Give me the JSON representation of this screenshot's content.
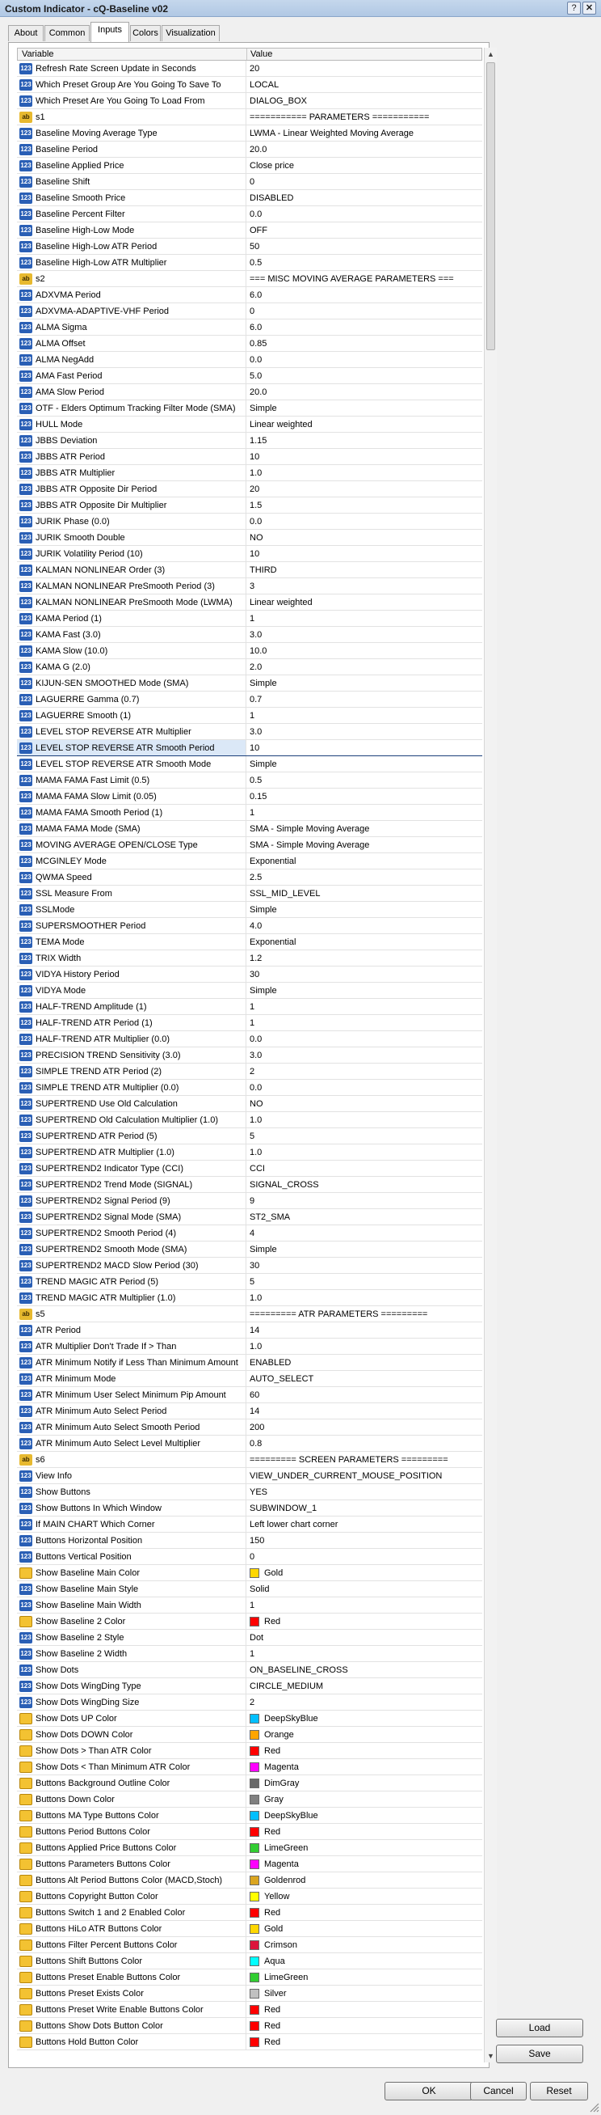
{
  "window": {
    "title": "Custom Indicator - cQ-Baseline v02",
    "help_glyph": "?",
    "close_glyph": "✕"
  },
  "tabs": [
    "About",
    "Common",
    "Inputs",
    "Colors",
    "Visualization"
  ],
  "active_tab": "Inputs",
  "columns": {
    "variable": "Variable",
    "value": "Value"
  },
  "rows": [
    {
      "t": "n",
      "name": "Refresh Rate Screen Update in Seconds",
      "value": "20"
    },
    {
      "t": "n",
      "name": "Which Preset Group Are You Going To Save To",
      "value": "LOCAL"
    },
    {
      "t": "n",
      "name": "Which Preset Are You Going To Load From",
      "value": "DIALOG_BOX"
    },
    {
      "t": "s",
      "name": "s1",
      "value": "=========== PARAMETERS ==========="
    },
    {
      "t": "n",
      "name": "Baseline Moving Average Type",
      "value": "LWMA - Linear Weighted Moving Average"
    },
    {
      "t": "n",
      "name": "Baseline Period",
      "value": "20.0"
    },
    {
      "t": "n",
      "name": "Baseline Applied Price",
      "value": "Close price"
    },
    {
      "t": "n",
      "name": "Baseline Shift",
      "value": "0"
    },
    {
      "t": "n",
      "name": "Baseline Smooth Price",
      "value": "DISABLED"
    },
    {
      "t": "n",
      "name": "Baseline Percent Filter",
      "value": "0.0"
    },
    {
      "t": "n",
      "name": "Baseline High-Low Mode",
      "value": "OFF"
    },
    {
      "t": "n",
      "name": "Baseline High-Low ATR Period",
      "value": "50"
    },
    {
      "t": "n",
      "name": "Baseline High-Low ATR Multiplier",
      "value": "0.5"
    },
    {
      "t": "s",
      "name": "s2",
      "value": "=== MISC MOVING AVERAGE PARAMETERS ==="
    },
    {
      "t": "n",
      "name": "ADXVMA Period",
      "value": "6.0"
    },
    {
      "t": "n",
      "name": "ADXVMA-ADAPTIVE-VHF Period",
      "value": "0"
    },
    {
      "t": "n",
      "name": "ALMA Sigma",
      "value": "6.0"
    },
    {
      "t": "n",
      "name": "ALMA Offset",
      "value": "0.85"
    },
    {
      "t": "n",
      "name": "ALMA NegAdd",
      "value": "0.0"
    },
    {
      "t": "n",
      "name": "AMA Fast Period",
      "value": "5.0"
    },
    {
      "t": "n",
      "name": "AMA Slow Period",
      "value": "20.0"
    },
    {
      "t": "n",
      "name": "OTF - Elders Optimum Tracking Filter Mode (SMA)",
      "value": "Simple"
    },
    {
      "t": "n",
      "name": "HULL Mode",
      "value": "Linear weighted"
    },
    {
      "t": "n",
      "name": "JBBS Deviation",
      "value": "1.15"
    },
    {
      "t": "n",
      "name": "JBBS ATR Period",
      "value": "10"
    },
    {
      "t": "n",
      "name": "JBBS ATR Multiplier",
      "value": "1.0"
    },
    {
      "t": "n",
      "name": "JBBS ATR Opposite Dir Period",
      "value": "20"
    },
    {
      "t": "n",
      "name": "JBBS ATR Opposite Dir Multiplier",
      "value": "1.5"
    },
    {
      "t": "n",
      "name": "JURIK Phase (0.0)",
      "value": "0.0"
    },
    {
      "t": "n",
      "name": "JURIK Smooth Double",
      "value": "NO"
    },
    {
      "t": "n",
      "name": "JURIK Volatility Period (10)",
      "value": "10"
    },
    {
      "t": "n",
      "name": "KALMAN NONLINEAR Order (3)",
      "value": "THIRD"
    },
    {
      "t": "n",
      "name": "KALMAN NONLINEAR PreSmooth Period (3)",
      "value": "3"
    },
    {
      "t": "n",
      "name": "KALMAN NONLINEAR PreSmooth Mode (LWMA)",
      "value": "Linear weighted"
    },
    {
      "t": "n",
      "name": "KAMA Period (1)",
      "value": "1"
    },
    {
      "t": "n",
      "name": "KAMA Fast (3.0)",
      "value": "3.0"
    },
    {
      "t": "n",
      "name": "KAMA Slow (10.0)",
      "value": "10.0"
    },
    {
      "t": "n",
      "name": "KAMA G (2.0)",
      "value": "2.0"
    },
    {
      "t": "n",
      "name": "KIJUN-SEN SMOOTHED Mode (SMA)",
      "value": "Simple"
    },
    {
      "t": "n",
      "name": "LAGUERRE Gamma (0.7)",
      "value": "0.7"
    },
    {
      "t": "n",
      "name": "LAGUERRE Smooth (1)",
      "value": "1"
    },
    {
      "t": "n",
      "name": "LEVEL STOP REVERSE ATR Multiplier",
      "value": "3.0"
    },
    {
      "t": "n",
      "name": "LEVEL STOP REVERSE ATR Smooth Period",
      "value": "10",
      "sel": true
    },
    {
      "t": "n",
      "name": "LEVEL STOP REVERSE ATR Smooth Mode",
      "value": "Simple"
    },
    {
      "t": "n",
      "name": "MAMA FAMA Fast Limit (0.5)",
      "value": "0.5"
    },
    {
      "t": "n",
      "name": "MAMA FAMA Slow Limit (0.05)",
      "value": "0.15"
    },
    {
      "t": "n",
      "name": "MAMA FAMA Smooth Period (1)",
      "value": "1"
    },
    {
      "t": "n",
      "name": "MAMA FAMA Mode (SMA)",
      "value": "SMA - Simple Moving Average"
    },
    {
      "t": "n",
      "name": "MOVING AVERAGE OPEN/CLOSE Type",
      "value": "SMA - Simple Moving Average"
    },
    {
      "t": "n",
      "name": "MCGINLEY Mode",
      "value": "Exponential"
    },
    {
      "t": "n",
      "name": "QWMA Speed",
      "value": "2.5"
    },
    {
      "t": "n",
      "name": "SSL Measure From",
      "value": "SSL_MID_LEVEL"
    },
    {
      "t": "n",
      "name": "SSLMode",
      "value": "Simple"
    },
    {
      "t": "n",
      "name": "SUPERSMOOTHER Period",
      "value": "4.0"
    },
    {
      "t": "n",
      "name": "TEMA Mode",
      "value": "Exponential"
    },
    {
      "t": "n",
      "name": "TRIX Width",
      "value": "1.2"
    },
    {
      "t": "n",
      "name": "VIDYA History Period",
      "value": "30"
    },
    {
      "t": "n",
      "name": "VIDYA Mode",
      "value": "Simple"
    },
    {
      "t": "n",
      "name": "HALF-TREND Amplitude (1)",
      "value": "1"
    },
    {
      "t": "n",
      "name": "HALF-TREND ATR Period (1)",
      "value": "1"
    },
    {
      "t": "n",
      "name": "HALF-TREND ATR Multiplier (0.0)",
      "value": "0.0"
    },
    {
      "t": "n",
      "name": "PRECISION TREND Sensitivity (3.0)",
      "value": "3.0"
    },
    {
      "t": "n",
      "name": "SIMPLE TREND ATR Period (2)",
      "value": "2"
    },
    {
      "t": "n",
      "name": "SIMPLE TREND ATR Multiplier (0.0)",
      "value": "0.0"
    },
    {
      "t": "n",
      "name": "SUPERTREND Use Old Calculation",
      "value": "NO"
    },
    {
      "t": "n",
      "name": "SUPERTREND Old Calculation Multiplier (1.0)",
      "value": "1.0"
    },
    {
      "t": "n",
      "name": "SUPERTREND ATR Period (5)",
      "value": "5"
    },
    {
      "t": "n",
      "name": "SUPERTREND ATR Multiplier (1.0)",
      "value": "1.0"
    },
    {
      "t": "n",
      "name": "SUPERTREND2 Indicator Type (CCI)",
      "value": "CCI"
    },
    {
      "t": "n",
      "name": "SUPERTREND2 Trend Mode (SIGNAL)",
      "value": "SIGNAL_CROSS"
    },
    {
      "t": "n",
      "name": "SUPERTREND2 Signal Period (9)",
      "value": "9"
    },
    {
      "t": "n",
      "name": "SUPERTREND2 Signal Mode (SMA)",
      "value": "ST2_SMA"
    },
    {
      "t": "n",
      "name": "SUPERTREND2 Smooth Period (4)",
      "value": "4"
    },
    {
      "t": "n",
      "name": "SUPERTREND2 Smooth Mode (SMA)",
      "value": "Simple"
    },
    {
      "t": "n",
      "name": "SUPERTREND2 MACD Slow Period (30)",
      "value": "30"
    },
    {
      "t": "n",
      "name": "TREND MAGIC ATR Period (5)",
      "value": "5"
    },
    {
      "t": "n",
      "name": "TREND MAGIC ATR Multiplier (1.0)",
      "value": "1.0"
    },
    {
      "t": "s",
      "name": "s5",
      "value": "========= ATR PARAMETERS ========="
    },
    {
      "t": "n",
      "name": "ATR Period",
      "value": "14"
    },
    {
      "t": "n",
      "name": "ATR Multiplier Don't Trade If > Than",
      "value": "1.0"
    },
    {
      "t": "n",
      "name": "ATR Minimum Notify if Less Than Minimum Amount",
      "value": "ENABLED"
    },
    {
      "t": "n",
      "name": "ATR Minimum Mode",
      "value": "AUTO_SELECT"
    },
    {
      "t": "n",
      "name": "ATR Minimum User Select Minimum Pip Amount",
      "value": "60"
    },
    {
      "t": "n",
      "name": "ATR Minimum Auto Select Period",
      "value": "14"
    },
    {
      "t": "n",
      "name": "ATR Minimum Auto Select Smooth Period",
      "value": "200"
    },
    {
      "t": "n",
      "name": "ATR Minimum Auto Select Level Multiplier",
      "value": "0.8"
    },
    {
      "t": "s",
      "name": "s6",
      "value": "========= SCREEN PARAMETERS ========="
    },
    {
      "t": "n",
      "name": "View Info",
      "value": "VIEW_UNDER_CURRENT_MOUSE_POSITION"
    },
    {
      "t": "n",
      "name": "Show Buttons",
      "value": "YES"
    },
    {
      "t": "n",
      "name": "Show Buttons In Which Window",
      "value": "SUBWINDOW_1"
    },
    {
      "t": "n",
      "name": "If MAIN CHART Which Corner",
      "value": "Left lower chart corner"
    },
    {
      "t": "n",
      "name": "Buttons Horizontal Position",
      "value": "150"
    },
    {
      "t": "n",
      "name": "Buttons Vertical Position",
      "value": "0"
    },
    {
      "t": "c",
      "name": "Show Baseline Main Color",
      "value": "Gold",
      "color": "#FFD700"
    },
    {
      "t": "n",
      "name": "Show Baseline Main Style",
      "value": "Solid"
    },
    {
      "t": "n",
      "name": "Show Baseline Main Width",
      "value": "1"
    },
    {
      "t": "c",
      "name": "Show Baseline 2 Color",
      "value": "Red",
      "color": "#FF0000"
    },
    {
      "t": "n",
      "name": "Show Baseline 2 Style",
      "value": "Dot"
    },
    {
      "t": "n",
      "name": "Show Baseline 2 Width",
      "value": "1"
    },
    {
      "t": "n",
      "name": "Show Dots",
      "value": "ON_BASELINE_CROSS"
    },
    {
      "t": "n",
      "name": "Show Dots WingDing Type",
      "value": "CIRCLE_MEDIUM"
    },
    {
      "t": "n",
      "name": "Show Dots WingDing Size",
      "value": "2"
    },
    {
      "t": "c",
      "name": "Show Dots UP Color",
      "value": "DeepSkyBlue",
      "color": "#00BFFF"
    },
    {
      "t": "c",
      "name": "Show Dots DOWN Color",
      "value": "Orange",
      "color": "#FFA500"
    },
    {
      "t": "c",
      "name": "Show Dots > Than ATR Color",
      "value": "Red",
      "color": "#FF0000"
    },
    {
      "t": "c",
      "name": "Show Dots < Than Minimum ATR Color",
      "value": "Magenta",
      "color": "#FF00FF"
    },
    {
      "t": "c",
      "name": "Buttons Background Outline Color",
      "value": "DimGray",
      "color": "#696969"
    },
    {
      "t": "c",
      "name": "Buttons Down Color",
      "value": "Gray",
      "color": "#808080"
    },
    {
      "t": "c",
      "name": "Buttons MA Type Buttons Color",
      "value": "DeepSkyBlue",
      "color": "#00BFFF"
    },
    {
      "t": "c",
      "name": "Buttons Period Buttons Color",
      "value": "Red",
      "color": "#FF0000"
    },
    {
      "t": "c",
      "name": "Buttons Applied Price Buttons Color",
      "value": "LimeGreen",
      "color": "#32CD32"
    },
    {
      "t": "c",
      "name": "Buttons Parameters Buttons Color",
      "value": "Magenta",
      "color": "#FF00FF"
    },
    {
      "t": "c",
      "name": "Buttons Alt Period Buttons Color (MACD,Stoch)",
      "value": "Goldenrod",
      "color": "#DAA520"
    },
    {
      "t": "c",
      "name": "Buttons Copyright Button Color",
      "value": "Yellow",
      "color": "#FFFF00"
    },
    {
      "t": "c",
      "name": "Buttons Switch 1 and 2 Enabled Color",
      "value": "Red",
      "color": "#FF0000"
    },
    {
      "t": "c",
      "name": "Buttons HiLo ATR Buttons Color",
      "value": "Gold",
      "color": "#FFD700"
    },
    {
      "t": "c",
      "name": "Buttons Filter Percent Buttons Color",
      "value": "Crimson",
      "color": "#DC143C"
    },
    {
      "t": "c",
      "name": "Buttons Shift Buttons Color",
      "value": "Aqua",
      "color": "#00FFFF"
    },
    {
      "t": "c",
      "name": "Buttons Preset Enable Buttons Color",
      "value": "LimeGreen",
      "color": "#32CD32"
    },
    {
      "t": "c",
      "name": "Buttons Preset Exists Color",
      "value": "Silver",
      "color": "#C0C0C0"
    },
    {
      "t": "c",
      "name": "Buttons Preset Write Enable Buttons Color",
      "value": "Red",
      "color": "#FF0000"
    },
    {
      "t": "c",
      "name": "Buttons Show Dots Button Color",
      "value": "Red",
      "color": "#FF0000"
    },
    {
      "t": "c",
      "name": "Buttons Hold Button Color",
      "value": "Red",
      "color": "#FF0000"
    }
  ],
  "icon_labels": {
    "n": "123",
    "s": "ab",
    "c": ""
  },
  "buttons": {
    "load": "Load",
    "save": "Save",
    "ok": "OK",
    "cancel": "Cancel",
    "reset": "Reset"
  }
}
